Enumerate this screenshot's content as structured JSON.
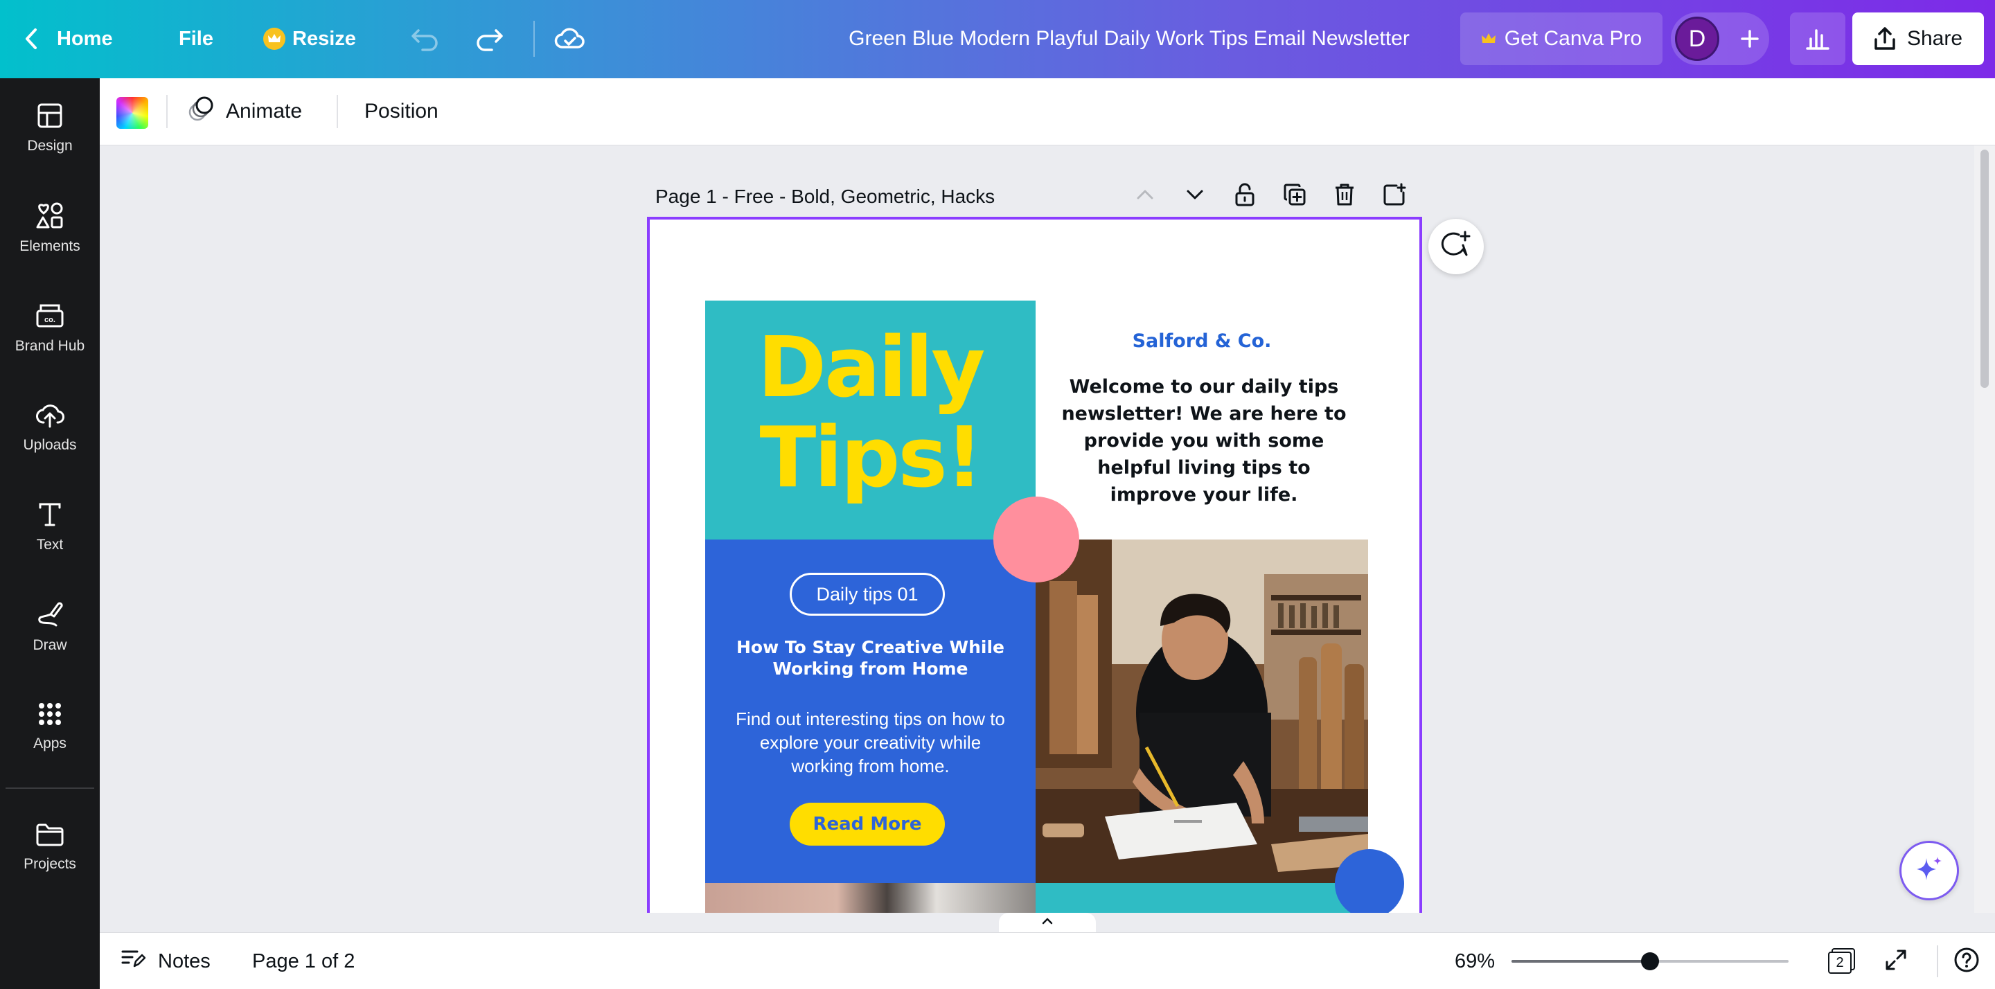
{
  "topbar": {
    "home_label": "Home",
    "file_label": "File",
    "resize_label": "Resize",
    "document_title": "Green Blue Modern Playful Daily Work Tips Email Newsletter",
    "pro_label": "Get Canva Pro",
    "avatar_initial": "D",
    "share_label": "Share"
  },
  "sidebar": {
    "items": [
      {
        "label": "Design",
        "icon": "layout-icon"
      },
      {
        "label": "Elements",
        "icon": "shapes-icon"
      },
      {
        "label": "Brand Hub",
        "icon": "brand-hub-icon"
      },
      {
        "label": "Uploads",
        "icon": "cloud-upload-icon"
      },
      {
        "label": "Text",
        "icon": "text-icon"
      },
      {
        "label": "Draw",
        "icon": "draw-icon"
      },
      {
        "label": "Apps",
        "icon": "apps-grid-icon"
      },
      {
        "label": "Projects",
        "icon": "folder-icon"
      }
    ]
  },
  "context_toolbar": {
    "animate_label": "Animate",
    "position_label": "Position"
  },
  "page": {
    "label": "Page 1 - Free - Bold, Geometric, Hacks"
  },
  "newsletter": {
    "title": "Daily Tips!",
    "brand": "Salford & Co.",
    "welcome": "Welcome to our daily tips newsletter! We are here to provide you with some helpful living tips to improve your life.",
    "pill": "Daily tips 01",
    "heading": "How To Stay Creative While Working from Home",
    "body": "Find out interesting tips on how to explore your creativity while working from home.",
    "cta": "Read More",
    "colors": {
      "teal": "#2fbcc4",
      "blue": "#2d64d9",
      "yellow": "#ffdd00",
      "pink": "#ff8f9d"
    }
  },
  "bottombar": {
    "notes_label": "Notes",
    "page_indicator": "Page 1 of 2",
    "zoom": "69%",
    "zoom_fraction": 0.5,
    "page_count": "2"
  },
  "colors": {
    "accent": "#8b3dff",
    "gradient_start": "#02c0cc",
    "gradient_end": "#7d2ae8"
  }
}
